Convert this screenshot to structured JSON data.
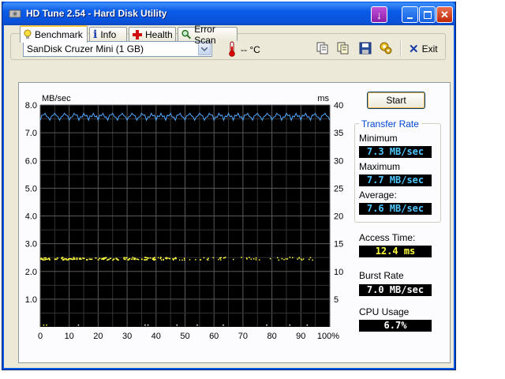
{
  "window": {
    "title": "HD Tune 2.54 - Hard Disk Utility"
  },
  "toolbar": {
    "drive": "SanDisk Cruzer Mini (1 GB)",
    "temperature": "-- °C",
    "exit_label": "Exit"
  },
  "tabs": [
    {
      "label": "Benchmark",
      "icon": "lightbulb-icon",
      "active": true
    },
    {
      "label": "Info",
      "icon": "info-icon",
      "active": false
    },
    {
      "label": "Health",
      "icon": "health-cross-icon",
      "active": false
    },
    {
      "label": "Error Scan",
      "icon": "magnifier-icon",
      "active": false
    }
  ],
  "benchmark": {
    "start_label": "Start",
    "transfer_rate_title": "Transfer Rate",
    "minimum_label": "Minimum",
    "minimum_value": "7.3 MB/sec",
    "maximum_label": "Maximum",
    "maximum_value": "7.7 MB/sec",
    "average_label": "Average:",
    "average_value": "7.6 MB/sec",
    "access_time_label": "Access Time:",
    "access_time_value": "12.4 ms",
    "burst_rate_label": "Burst Rate",
    "burst_rate_value": "7.0 MB/sec",
    "cpu_usage_label": "CPU Usage",
    "cpu_usage_value": "6.7%"
  },
  "chart_data": {
    "type": "line",
    "left_unit_label": "MB/sec",
    "right_unit_label": "ms",
    "ylim": [
      0,
      8
    ],
    "y2lim": [
      0,
      40
    ],
    "xlim": [
      0,
      100
    ],
    "x_ticks": [
      "0",
      "10",
      "20",
      "30",
      "40",
      "50",
      "60",
      "70",
      "80",
      "90",
      "100%"
    ],
    "y_ticks": [
      "1.0",
      "2.0",
      "3.0",
      "4.0",
      "5.0",
      "6.0",
      "7.0",
      "8.0"
    ],
    "y2_ticks": [
      "5",
      "10",
      "15",
      "20",
      "25",
      "30",
      "35",
      "40"
    ],
    "grid": true,
    "background": "#000000",
    "series": [
      {
        "color": "#4fa8ff",
        "style": "line",
        "approx_value": 7.6,
        "min": 7.3,
        "max": 7.7
      },
      {
        "color": "#ffff40",
        "style": "scatter",
        "y2_value": 12.4
      }
    ]
  }
}
